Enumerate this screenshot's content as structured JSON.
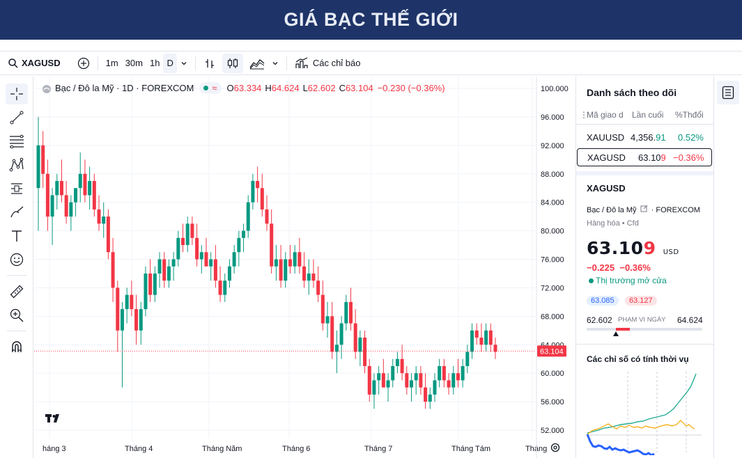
{
  "banner": {
    "title": "GIÁ BẠC THẾ GIỚI"
  },
  "toolbar": {
    "symbol": "XAGUSD",
    "intervals": [
      "1m",
      "30m",
      "1h",
      "D"
    ],
    "indicators_label": "Các chỉ báo"
  },
  "legend": {
    "title": "Bạc / Đô la Mỹ · 1D · FOREXCOM",
    "o_label": "O",
    "o_value": "63.334",
    "h_label": "H",
    "h_value": "64.624",
    "l_label": "L",
    "l_value": "62.602",
    "c_label": "C",
    "c_value": "63.104",
    "change": "−0.230 (−0.36%)"
  },
  "chart_data": {
    "type": "candlestick",
    "symbol": "XAGUSD",
    "y_ticks": [
      "100.000",
      "96.000",
      "92.000",
      "88.000",
      "84.000",
      "80.000",
      "76.000",
      "72.000",
      "68.000",
      "64.000",
      "60.000",
      "56.000",
      "52.000"
    ],
    "ylim": [
      50,
      100
    ],
    "x_ticks": [
      "háng 3",
      "Tháng 4",
      "Tháng Năm",
      "Tháng 6",
      "Tháng 7",
      "Tháng Tám",
      "Tháng"
    ],
    "last_price_label": "63.104",
    "last_price": 63.104,
    "candles": [
      [
        86,
        96,
        80,
        92
      ],
      [
        92,
        94,
        86,
        88
      ],
      [
        88,
        90,
        80,
        82
      ],
      [
        82,
        86,
        78,
        85
      ],
      [
        85,
        88,
        83,
        87
      ],
      [
        87,
        90,
        84,
        85
      ],
      [
        85,
        87,
        81,
        82
      ],
      [
        82,
        85,
        80,
        84
      ],
      [
        84,
        86,
        82,
        86
      ],
      [
        86,
        91,
        84,
        88
      ],
      [
        88,
        90,
        84,
        85
      ],
      [
        85,
        89,
        83,
        87
      ],
      [
        87,
        88,
        82,
        83
      ],
      [
        83,
        85,
        80,
        81
      ],
      [
        81,
        84,
        79,
        82
      ],
      [
        82,
        83,
        76,
        77
      ],
      [
        77,
        79,
        70,
        72
      ],
      [
        72,
        73,
        63,
        66
      ],
      [
        66,
        70,
        58,
        69
      ],
      [
        69,
        72,
        67,
        71
      ],
      [
        71,
        73,
        68,
        69
      ],
      [
        69,
        71,
        64,
        66
      ],
      [
        66,
        70,
        64,
        69
      ],
      [
        69,
        75,
        68,
        74
      ],
      [
        74,
        76,
        70,
        71
      ],
      [
        71,
        75,
        70,
        74
      ],
      [
        74,
        77,
        72,
        76
      ],
      [
        76,
        77,
        72,
        73
      ],
      [
        73,
        76,
        72,
        75
      ],
      [
        75,
        77,
        73,
        76
      ],
      [
        76,
        80,
        75,
        79
      ],
      [
        79,
        81,
        77,
        78
      ],
      [
        78,
        82,
        77,
        81
      ],
      [
        81,
        82,
        78,
        79
      ],
      [
        79,
        81,
        75,
        76
      ],
      [
        76,
        78,
        74,
        77
      ],
      [
        77,
        79,
        75,
        75
      ],
      [
        75,
        77,
        73,
        76
      ],
      [
        76,
        78,
        72,
        73
      ],
      [
        73,
        75,
        70,
        71
      ],
      [
        71,
        74,
        70,
        73
      ],
      [
        73,
        76,
        72,
        75
      ],
      [
        75,
        78,
        74,
        77
      ],
      [
        77,
        80,
        75,
        79
      ],
      [
        79,
        81,
        77,
        80
      ],
      [
        80,
        85,
        79,
        84
      ],
      [
        84,
        88,
        83,
        87
      ],
      [
        87,
        89,
        84,
        86
      ],
      [
        86,
        88,
        82,
        83
      ],
      [
        83,
        85,
        80,
        81
      ],
      [
        81,
        83,
        74,
        75
      ],
      [
        75,
        78,
        73,
        76
      ],
      [
        76,
        78,
        72,
        73
      ],
      [
        73,
        77,
        72,
        76
      ],
      [
        76,
        78,
        74,
        75
      ],
      [
        75,
        78,
        74,
        77
      ],
      [
        77,
        79,
        74,
        75
      ],
      [
        75,
        77,
        72,
        73
      ],
      [
        73,
        76,
        71,
        74
      ],
      [
        74,
        76,
        72,
        73
      ],
      [
        73,
        75,
        70,
        71
      ],
      [
        71,
        73,
        66,
        67
      ],
      [
        67,
        70,
        65,
        68
      ],
      [
        68,
        70,
        62,
        63
      ],
      [
        63,
        66,
        60,
        64
      ],
      [
        64,
        68,
        62,
        67
      ],
      [
        67,
        71,
        66,
        70
      ],
      [
        70,
        72,
        66,
        67
      ],
      [
        67,
        69,
        62,
        63
      ],
      [
        63,
        66,
        61,
        65
      ],
      [
        65,
        66,
        60,
        61
      ],
      [
        61,
        62,
        56,
        57
      ],
      [
        57,
        60,
        55,
        59
      ],
      [
        59,
        61,
        57,
        60
      ],
      [
        60,
        62,
        58,
        58
      ],
      [
        58,
        60,
        56,
        59
      ],
      [
        59,
        62,
        58,
        61
      ],
      [
        61,
        63,
        60,
        62
      ],
      [
        62,
        64,
        59,
        60
      ],
      [
        60,
        61,
        57,
        58
      ],
      [
        58,
        60,
        56,
        59
      ],
      [
        59,
        61,
        57,
        60
      ],
      [
        60,
        61,
        57,
        58
      ],
      [
        58,
        60,
        55,
        56
      ],
      [
        56,
        58,
        55,
        57
      ],
      [
        57,
        60,
        56,
        59
      ],
      [
        59,
        62,
        58,
        61
      ],
      [
        61,
        62,
        58,
        59
      ],
      [
        59,
        60,
        57,
        58
      ],
      [
        58,
        61,
        57,
        60
      ],
      [
        60,
        62,
        58,
        59
      ],
      [
        59,
        62,
        58,
        61
      ],
      [
        61,
        64,
        60,
        63
      ],
      [
        63,
        67,
        62,
        66
      ],
      [
        66,
        67,
        64,
        65
      ],
      [
        65,
        67,
        63,
        64
      ],
      [
        64,
        67,
        63,
        66
      ],
      [
        66,
        67,
        63,
        64
      ],
      [
        64,
        65,
        62,
        63
      ]
    ]
  },
  "watchlist": {
    "title": "Danh sách theo dõi",
    "headers": [
      "Mã giao d",
      "Lần cuối",
      "%Thđổi"
    ],
    "rows": [
      {
        "symbol": "XAUUSD",
        "last_main": "4,356.",
        "last_tail": "91",
        "change": "0.52%",
        "dir": "up"
      },
      {
        "symbol": "XAGUSD",
        "last_main": "63.10",
        "last_tail": "9",
        "change": "−0.36%",
        "dir": "down"
      }
    ]
  },
  "details": {
    "symbol": "XAGUSD",
    "name": "Bạc / Đô la Mỹ",
    "exchange_sep": "·",
    "exchange": "FOREXCOM",
    "category": "Hàng hóa",
    "type": "Cfd",
    "price_main": "63.10",
    "price_tail": "9",
    "currency": "USD",
    "change_abs": "−0.225",
    "change_pct": "−0.36%",
    "market_status": "Thị trường mở cửa",
    "bid": "63.085",
    "ask": "63.127",
    "range_low": "62.602",
    "range_label": "PHẠM VI NGÀY",
    "range_high": "64.624",
    "range_position": 0.25
  },
  "seasonal": {
    "title": "Các chỉ số có tính thời vụ"
  },
  "colors": {
    "up": "#089981",
    "down": "#f23645",
    "banner": "#1e3468",
    "accent": "#2962ff"
  }
}
